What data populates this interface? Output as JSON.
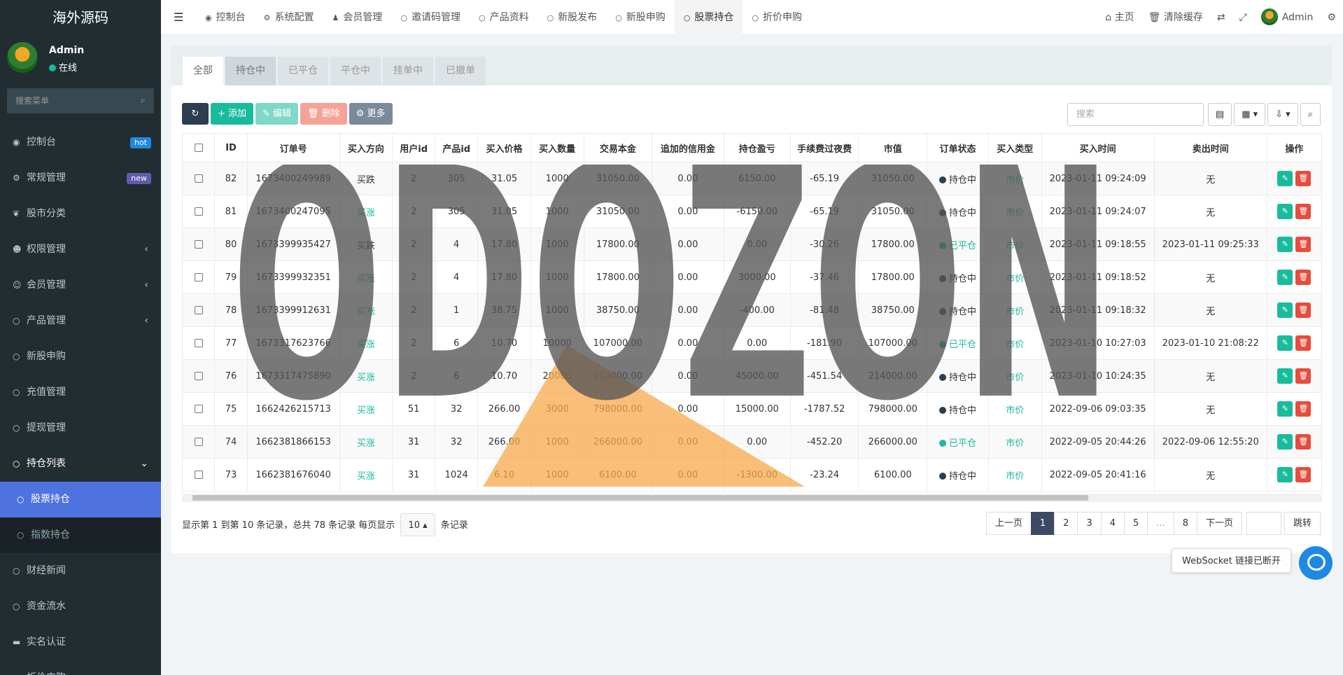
{
  "app": {
    "logo": "海外源码"
  },
  "user": {
    "name": "Admin",
    "status": "在线"
  },
  "sidebar": {
    "search_placeholder": "搜索菜单",
    "items": [
      {
        "icon": "dashboard-icon",
        "glyph": "◉",
        "label": "控制台",
        "badge": "hot"
      },
      {
        "icon": "cogs-icon",
        "glyph": "⚙",
        "label": "常规管理",
        "badge": "new"
      },
      {
        "icon": "leaf-icon",
        "glyph": "❦",
        "label": "股市分类"
      },
      {
        "icon": "group-icon",
        "glyph": "☻",
        "label": "权限管理",
        "arrow": "‹"
      },
      {
        "icon": "user-circle-icon",
        "glyph": "☺",
        "label": "会员管理",
        "arrow": "‹"
      },
      {
        "icon": "circle-icon",
        "glyph": "○",
        "label": "产品管理",
        "arrow": "‹"
      },
      {
        "icon": "circle-icon",
        "glyph": "○",
        "label": "新股申购"
      },
      {
        "icon": "circle-icon",
        "glyph": "○",
        "label": "充值管理"
      },
      {
        "icon": "circle-icon",
        "glyph": "○",
        "label": "提现管理"
      },
      {
        "icon": "circle-icon",
        "glyph": "○",
        "label": "持仓列表",
        "arrow": "⌄",
        "open": true
      },
      {
        "icon": "circle-icon",
        "glyph": "○",
        "label": "股票持仓",
        "active": true,
        "sub": true
      },
      {
        "icon": "circle-icon",
        "glyph": "○",
        "label": "指数持仓",
        "sub": true
      },
      {
        "icon": "circle-icon",
        "glyph": "○",
        "label": "财经新闻"
      },
      {
        "icon": "circle-icon",
        "glyph": "○",
        "label": "资金流水"
      },
      {
        "icon": "credit-card-icon",
        "glyph": "▬",
        "label": "实名认证"
      },
      {
        "icon": "circle-icon",
        "glyph": "○",
        "label": "折价申购"
      }
    ]
  },
  "topbar": {
    "tabs": [
      {
        "glyph": "◉",
        "icon": "dashboard-icon",
        "label": "控制台"
      },
      {
        "glyph": "⚙",
        "icon": "cog-icon",
        "label": "系统配置"
      },
      {
        "glyph": "♟",
        "icon": "user-icon",
        "label": "会员管理"
      },
      {
        "glyph": "○",
        "icon": "circle-icon",
        "label": "邀请码管理"
      },
      {
        "glyph": "○",
        "icon": "circle-icon",
        "label": "产品资料"
      },
      {
        "glyph": "○",
        "icon": "circle-icon",
        "label": "新股发布"
      },
      {
        "glyph": "○",
        "icon": "circle-icon",
        "label": "新股申购"
      },
      {
        "glyph": "○",
        "icon": "circle-icon",
        "label": "股票持仓",
        "active": true
      },
      {
        "glyph": "○",
        "icon": "circle-icon",
        "label": "折价申购"
      }
    ],
    "right": {
      "home_label": "主页",
      "clear_cache_label": "清除缓存",
      "translate_glyph": "⇄",
      "fullscreen_glyph": "⤢",
      "user_label": "Admin",
      "settings_glyph": "⚙"
    }
  },
  "filter_tabs": [
    {
      "label": "全部",
      "active": true
    },
    {
      "label": "持仓中",
      "dark": true
    },
    {
      "label": "已平仓"
    },
    {
      "label": "平仓中"
    },
    {
      "label": "挂单中"
    },
    {
      "label": "已撤单"
    }
  ],
  "toolbar": {
    "refresh_glyph": "↻",
    "add_label": "+ 添加",
    "edit_label": "✎ 编辑",
    "delete_label": "🗑 删除",
    "more_label": "⚙ 更多",
    "search_placeholder": "搜索",
    "view_glyph": "▤",
    "columns_glyph": "▦ ▾",
    "export_glyph": "⇩ ▾",
    "search_glyph": "⌕"
  },
  "table": {
    "headers": [
      "",
      "ID",
      "订单号",
      "买入方向",
      "用户id",
      "产品id",
      "买入价格",
      "买入数量",
      "交易本金",
      "追加的信用金",
      "持仓盈亏",
      "手续费过夜费",
      "市值",
      "订单状态",
      "买入类型",
      "买入时间",
      "卖出时间",
      "操作"
    ],
    "rows": [
      [
        "82",
        "1673400249989",
        "买跌",
        "2",
        "305",
        "31.05",
        "1000",
        "31050.00",
        "0.00",
        "6150.00",
        "-65.19",
        "31050.00",
        "持仓中",
        "市价",
        "2023-01-11 09:24:09",
        "无"
      ],
      [
        "81",
        "1673400247095",
        "买涨",
        "2",
        "305",
        "31.05",
        "1000",
        "31050.00",
        "0.00",
        "-6150.00",
        "-65.19",
        "31050.00",
        "持仓中",
        "市价",
        "2023-01-11 09:24:07",
        "无"
      ],
      [
        "80",
        "1673399935427",
        "买跌",
        "2",
        "4",
        "17.80",
        "1000",
        "17800.00",
        "0.00",
        "0.00",
        "-30.26",
        "17800.00",
        "已平仓",
        "市价",
        "2023-01-11 09:18:55",
        "2023-01-11 09:25:33"
      ],
      [
        "79",
        "1673399932351",
        "买涨",
        "2",
        "4",
        "17.80",
        "1000",
        "17800.00",
        "0.00",
        "3000.00",
        "-37.46",
        "17800.00",
        "持仓中",
        "市价",
        "2023-01-11 09:18:52",
        "无"
      ],
      [
        "78",
        "1673399912631",
        "买涨",
        "2",
        "1",
        "38.75",
        "1000",
        "38750.00",
        "0.00",
        "-400.00",
        "-81.48",
        "38750.00",
        "持仓中",
        "市价",
        "2023-01-11 09:18:32",
        "无"
      ],
      [
        "77",
        "1673317623766",
        "买涨",
        "2",
        "6",
        "10.70",
        "10000",
        "107000.00",
        "0.00",
        "0.00",
        "-181.90",
        "107000.00",
        "已平仓",
        "市价",
        "2023-01-10 10:27:03",
        "2023-01-10 21:08:22"
      ],
      [
        "76",
        "1673317475890",
        "买涨",
        "2",
        "6",
        "10.70",
        "20000",
        "214000.00",
        "0.00",
        "45000.00",
        "-451.54",
        "214000.00",
        "持仓中",
        "市价",
        "2023-01-10 10:24:35",
        "无"
      ],
      [
        "75",
        "1662426215713",
        "买涨",
        "51",
        "32",
        "266.00",
        "3000",
        "798000.00",
        "0.00",
        "15000.00",
        "-1787.52",
        "798000.00",
        "持仓中",
        "市价",
        "2022-09-06 09:03:35",
        "无"
      ],
      [
        "74",
        "1662381866153",
        "买涨",
        "31",
        "32",
        "266.00",
        "1000",
        "266000.00",
        "0.00",
        "0.00",
        "-452.20",
        "266000.00",
        "已平仓",
        "市价",
        "2022-09-05 20:44:26",
        "2022-09-06 12:55:20"
      ],
      [
        "73",
        "1662381676040",
        "买涨",
        "31",
        "1024",
        "6.10",
        "1000",
        "6100.00",
        "0.00",
        "-1300.00",
        "-23.24",
        "6100.00",
        "持仓中",
        "市价",
        "2022-09-05 20:41:16",
        "无"
      ]
    ],
    "edit_glyph": "✎",
    "delete_glyph": "🗑"
  },
  "colors": {
    "green": "#18bc9c",
    "status_open": "#2c3e50",
    "status_closed": "#18bc9c"
  },
  "pagination": {
    "info_prefix": "显示第 1 到第 10 条记录，总共 78 条记录 每页显示",
    "page_size": "10 ▴",
    "info_suffix": "条记录",
    "prev": "上一页",
    "pages": [
      "1",
      "2",
      "3",
      "4",
      "5",
      "...",
      "8"
    ],
    "next": "下一页",
    "go": "跳转"
  },
  "watermark": {
    "text": "ODOZON"
  },
  "websocket": {
    "tip": "WebSocket 链接已断开"
  }
}
